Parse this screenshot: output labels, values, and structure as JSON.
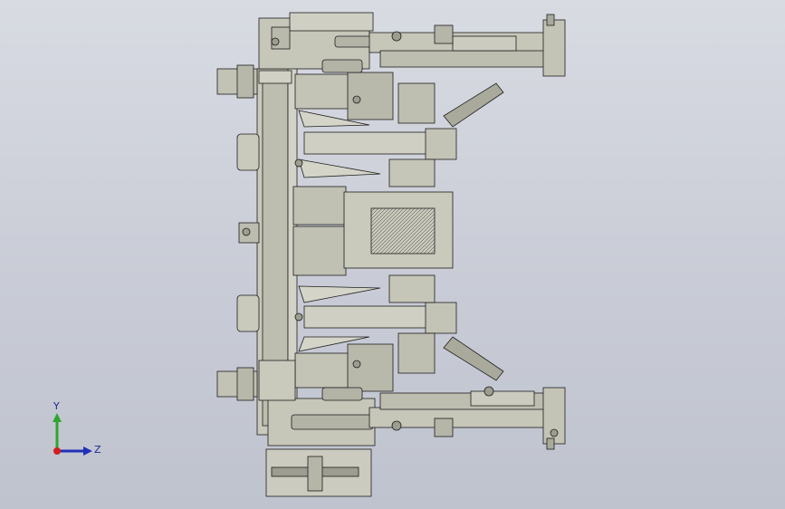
{
  "viewport": {
    "background_top": "#d8dbe2",
    "background_bottom": "#bfc3ce",
    "model_fill": "#c6c6b9",
    "model_fill_dark": "#a9a99c",
    "model_line": "#1e1e1e"
  },
  "triad": {
    "y_label": "Y",
    "z_label": "Z",
    "y_color": "#2fa62f",
    "z_color": "#2230b8",
    "origin_color": "#d41e1e"
  }
}
